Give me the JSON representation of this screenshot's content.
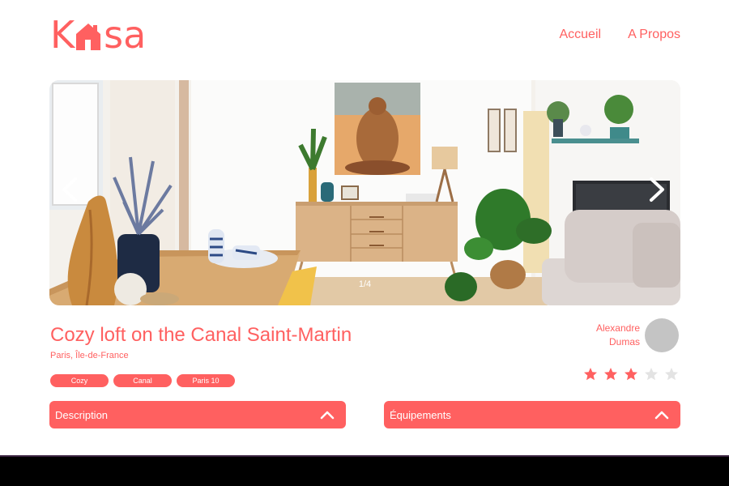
{
  "header": {
    "logo_parts": [
      "K",
      "sa"
    ],
    "logo_text": "Kasa",
    "nav": [
      {
        "label": "Accueil"
      },
      {
        "label": "A Propos"
      }
    ]
  },
  "carousel": {
    "counter": "1/4",
    "prev_icon": "chevron-left-icon",
    "next_icon": "chevron-right-icon"
  },
  "listing": {
    "title": "Cozy loft on the Canal Saint-Martin",
    "location": "Paris, Île-de-France",
    "tags": [
      "Cozy",
      "Canal",
      "Paris 10"
    ]
  },
  "host": {
    "first_name": "Alexandre",
    "last_name": "Dumas"
  },
  "rating": {
    "value": 3,
    "max": 5
  },
  "collapses": {
    "description_label": "Description",
    "equipment_label": "Équipements"
  },
  "colors": {
    "accent": "#FF6060",
    "star_off": "#E3E3E3",
    "avatar": "#C4C4C4"
  }
}
